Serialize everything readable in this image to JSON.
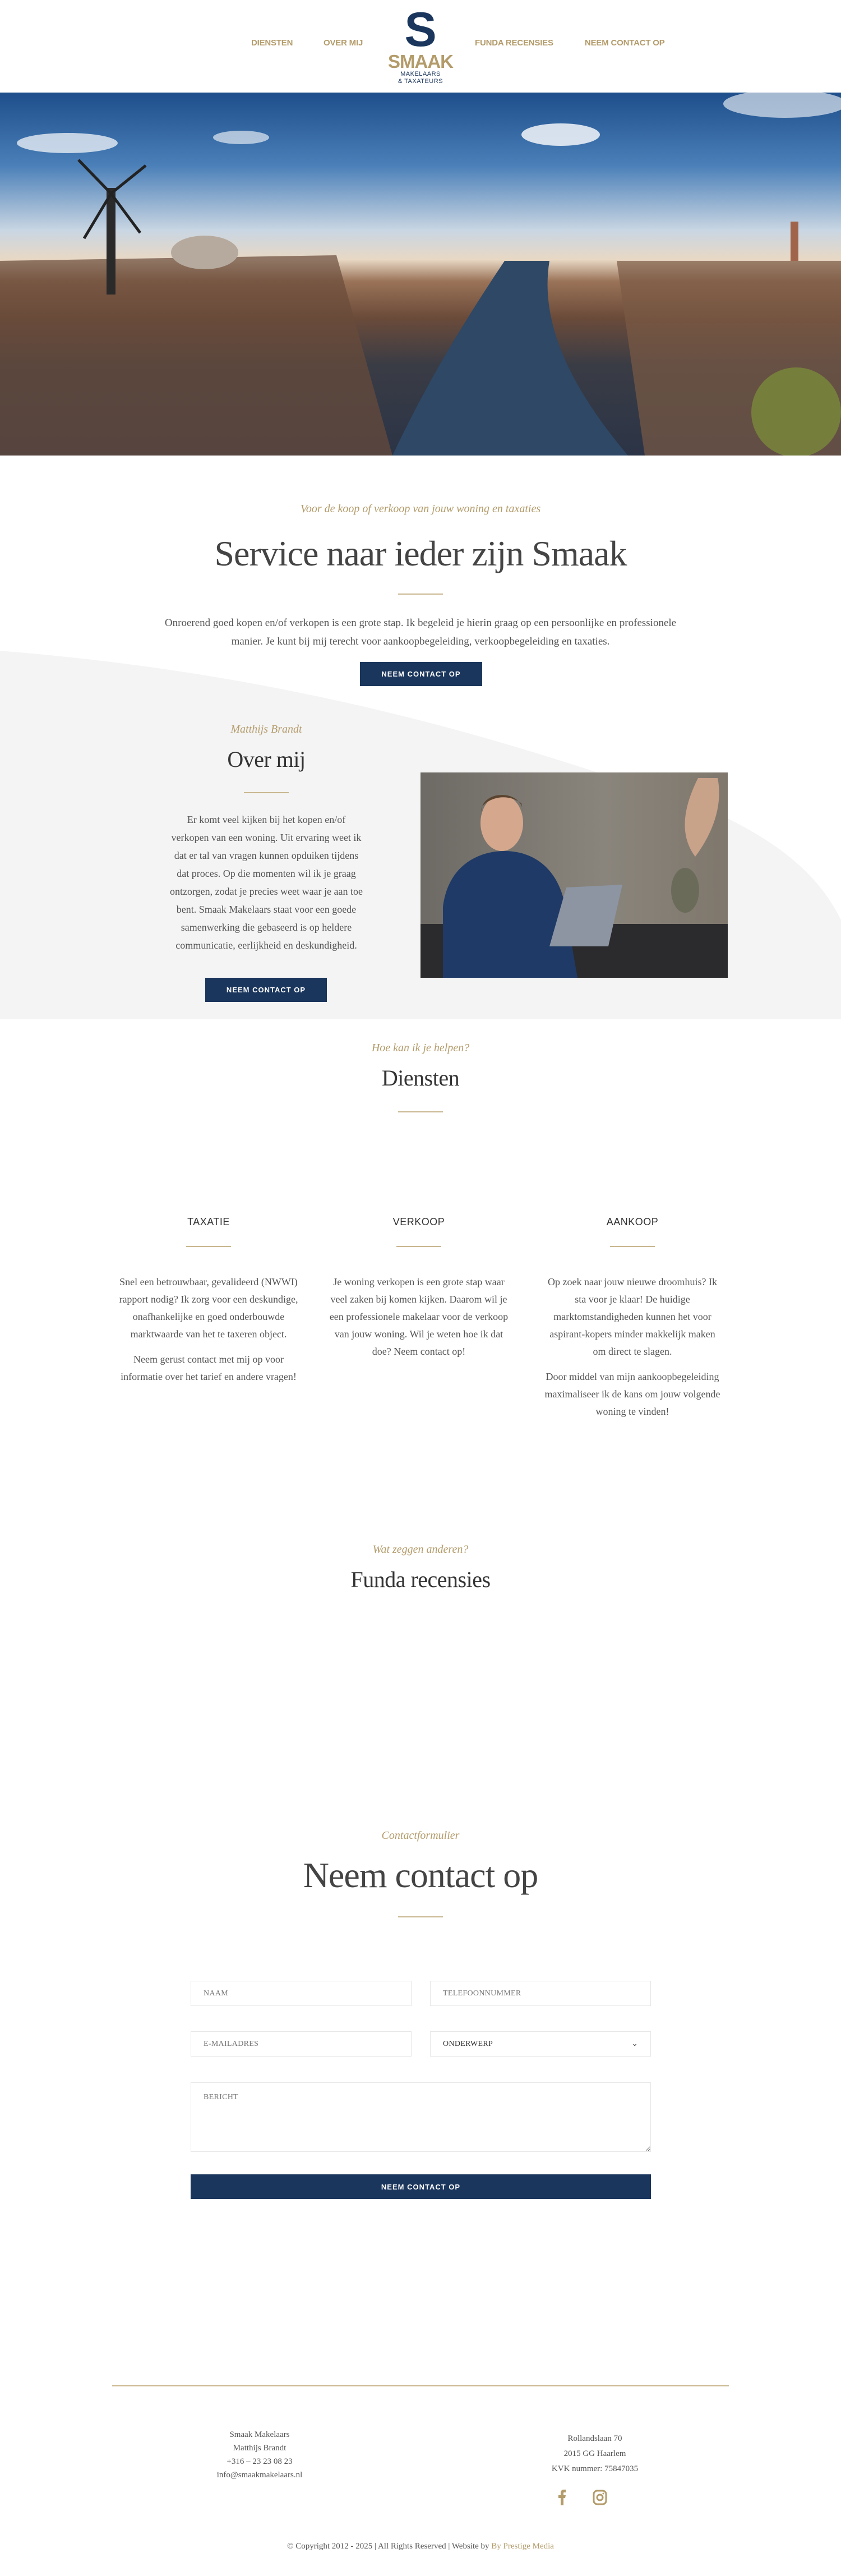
{
  "header": {
    "nav": [
      "DIENSTEN",
      "OVER MIJ",
      "FUNDA RECENSIES",
      "NEEM CONTACT OP"
    ],
    "logo": {
      "mark": "S",
      "brand": "SMAAK",
      "tagline1": "MAKELAARS",
      "tagline2": "& TAXATEURS"
    }
  },
  "intro": {
    "kicker": "Voor de koop of verkoop van jouw woning en taxaties",
    "title": "Service naar ieder zijn Smaak",
    "text_line1": "Onroerend goed kopen en/of verkopen is een grote stap. Ik begeleid je hierin graag op een persoonlijke en professionele",
    "text_line2": "manier. Je kunt bij mij terecht voor aankoopbegeleiding, verkoopbegeleiding en taxaties.",
    "button": "NEEM CONTACT OP"
  },
  "about": {
    "kicker": "Matthijs Brandt",
    "title": "Over mij",
    "text": "Er komt veel kijken bij het kopen en/of verkopen van een woning. Uit ervaring weet ik dat er tal van vragen kunnen opduiken tijdens dat proces. Op die momenten wil ik je graag ontzorgen, zodat je precies weet waar je aan toe bent. Smaak Makelaars staat voor een goede samenwerking die gebaseerd is op heldere communicatie, eerlijkheid en deskundigheid.",
    "button": "NEEM CONTACT OP"
  },
  "services": {
    "kicker": "Hoe kan ik je helpen?",
    "title": "Diensten",
    "items": [
      {
        "title": "TAXATIE",
        "p1": "Snel een betrouwbaar, gevalideerd (NWWI) rapport nodig? Ik zorg voor een deskundige, onafhankelijke en goed onderbouwde marktwaarde van het te taxeren object.",
        "p2": "Neem gerust contact met mij op voor informatie over het tarief en andere vragen!"
      },
      {
        "title": "VERKOOP",
        "p1": "Je woning verkopen is een grote stap waar veel zaken bij komen kijken. Daarom wil je een professionele makelaar voor de verkoop van jouw woning. Wil je weten hoe ik dat doe? Neem contact op!",
        "p2": ""
      },
      {
        "title": "AANKOOP",
        "p1": "Op zoek naar jouw nieuwe droomhuis? Ik sta voor je klaar! De huidige marktomstandigheden kunnen het voor aspirant-kopers minder makkelijk maken om direct te slagen.",
        "p2": "Door middel van mijn aankoopbegeleiding maximaliseer ik de kans om jouw volgende woning te vinden!"
      }
    ]
  },
  "reviews": {
    "kicker": "Wat zeggen anderen?",
    "title": "Funda recensies"
  },
  "contact": {
    "kicker": "Contactformulier",
    "title": "Neem contact op",
    "name_placeholder": "NAAM",
    "phone_placeholder": "TELEFOONNUMMER",
    "email_placeholder": "E-MAILADRES",
    "subject_selected": "ONDERWERP",
    "message_placeholder": "BERICHT",
    "submit": "NEEM CONTACT OP"
  },
  "footer": {
    "left": [
      "Smaak Makelaars",
      "Matthijs Brandt",
      "+316 – 23 23 08 23",
      "info@smaakmakelaars.nl"
    ],
    "right": [
      "Rollandslaan 70",
      "2015 GG Haarlem",
      "KVK nummer: 75847035"
    ],
    "social": [
      "facebook-icon",
      "instagram-icon"
    ],
    "copyright": "© Copyright 2012 - 2025 | All Rights Reserved | Website by ",
    "credit": "By Prestige Media"
  },
  "colors": {
    "navy": "#1b365d",
    "gold": "#b39b6a"
  }
}
